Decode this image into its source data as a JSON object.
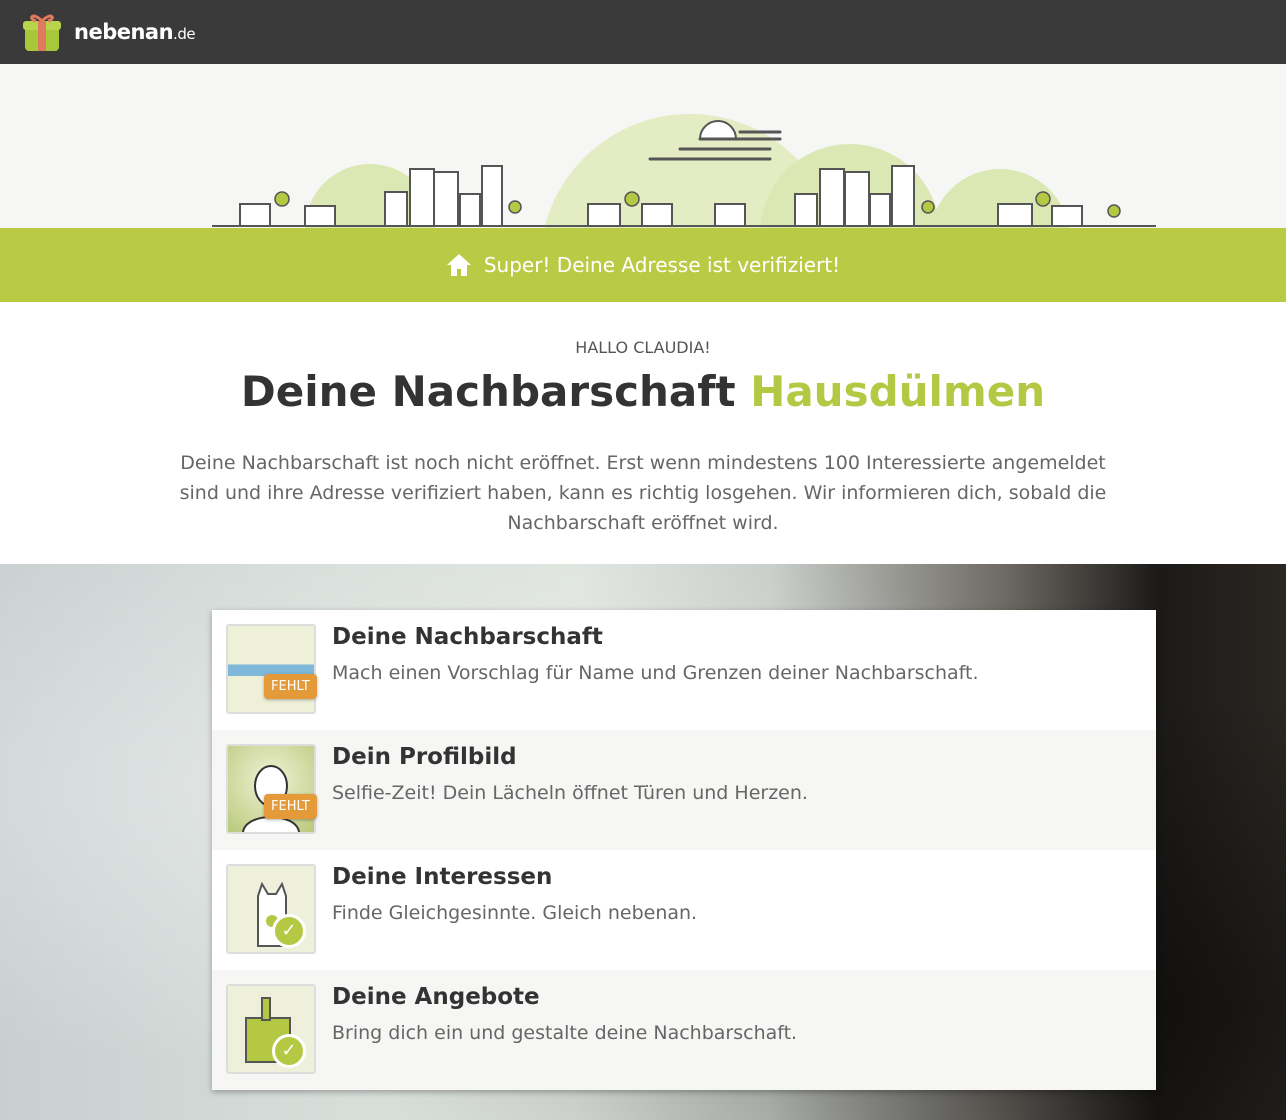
{
  "header": {
    "logo_main": "nebenan",
    "logo_tld": ".de"
  },
  "banner": {
    "text": "Super! Deine Adresse ist verifiziert!",
    "icon": "house-icon"
  },
  "intro": {
    "greeting": "HALLO CLAUDIA!",
    "title": "Deine Nachbarschaft",
    "neighborhood": "Hausdülmen",
    "description": "Deine Nachbarschaft ist noch nicht eröffnet. Erst wenn mindestens 100 Interessierte angemeldet sind und ihre Adresse verifiziert haben, kann es richtig losgehen. Wir informieren dich, sobald die Nachbarschaft eröffnet wird."
  },
  "steps": [
    {
      "title": "Deine Nachbarschaft",
      "description": "Mach einen Vorschlag für Name und Grenzen deiner Nachbarschaft.",
      "status": "FEHLT"
    },
    {
      "title": "Dein Profilbild",
      "description": "Selfie-Zeit! Dein Lächeln öffnet Türen und Herzen.",
      "status": "FEHLT"
    },
    {
      "title": "Deine Interessen",
      "description": "Finde Gleichgesinnte. Gleich nebenan.",
      "status": "✓"
    },
    {
      "title": "Deine Angebote",
      "description": "Bring dich ein und gestalte deine Nachbarschaft.",
      "status": "✓"
    }
  ],
  "colors": {
    "accent": "#b9cb45",
    "missing": "#e59a3a",
    "topbar": "#3a3a3a"
  }
}
